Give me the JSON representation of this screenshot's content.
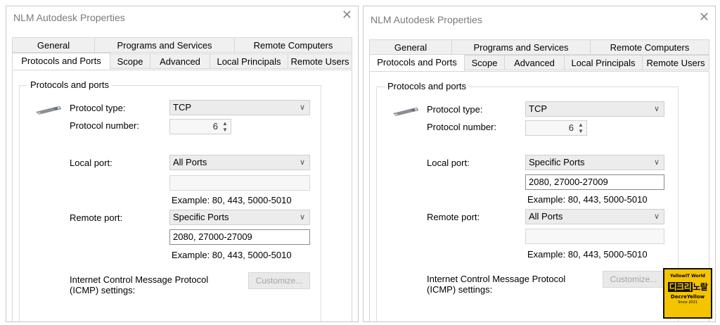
{
  "dialogs": [
    {
      "title": "NLM Autodesk Properties",
      "close_glyph": "✕",
      "tabs_row1": [
        "General",
        "Programs and Services",
        "Remote Computers"
      ],
      "tabs_row2": [
        "Protocols and Ports",
        "Scope",
        "Advanced",
        "Local Principals",
        "Remote Users"
      ],
      "selected_tab": "Protocols and Ports",
      "group_label": "Protocols and ports",
      "protocol_type_label": "Protocol type:",
      "protocol_type_value": "TCP",
      "protocol_number_label": "Protocol number:",
      "protocol_number_value": "6",
      "local_port_label": "Local port:",
      "local_port_value": "All Ports",
      "local_port_input": "",
      "local_example": "Example: 80, 443, 5000-5010",
      "remote_port_label": "Remote port:",
      "remote_port_value": "Specific Ports",
      "remote_port_input": "2080, 27000-27009",
      "remote_example": "Example: 80, 443, 5000-5010",
      "icmp_label_line1": "Internet Control Message Protocol",
      "icmp_label_line2": "(ICMP) settings:",
      "customize_label": "Customize..."
    },
    {
      "title": "NLM Autodesk Properties",
      "close_glyph": "✕",
      "tabs_row1": [
        "General",
        "Programs and Services",
        "Remote Computers"
      ],
      "tabs_row2": [
        "Protocols and Ports",
        "Scope",
        "Advanced",
        "Local Principals",
        "Remote Users"
      ],
      "selected_tab": "Protocols and Ports",
      "group_label": "Protocols and ports",
      "protocol_type_label": "Protocol type:",
      "protocol_type_value": "TCP",
      "protocol_number_label": "Protocol number:",
      "protocol_number_value": "6",
      "local_port_label": "Local port:",
      "local_port_value": "Specific Ports",
      "local_port_input": "2080, 27000-27009",
      "local_example": "Example: 80, 443, 5000-5010",
      "remote_port_label": "Remote port:",
      "remote_port_value": "All Ports",
      "remote_port_input": "",
      "remote_example": "Example: 80, 443, 5000-5010",
      "icmp_label_line1": "Internet Control Message Protocol",
      "icmp_label_line2": "(ICMP) settings:",
      "customize_label": "Customize..."
    }
  ],
  "watermark": {
    "line1": "YellowIT World",
    "line2a": "디크리",
    "line2b": "노랄",
    "line3": "DecreYellow",
    "line4": "Since 2021"
  },
  "colors": {
    "accent": "#f5c400",
    "disabled_text": "#a5a5a5"
  }
}
